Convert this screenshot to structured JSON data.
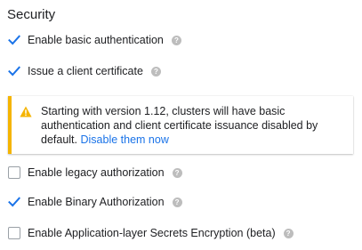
{
  "section": {
    "title": "Security"
  },
  "options": [
    {
      "label": "Enable basic authentication",
      "checked": true,
      "help_icon": "help-icon"
    },
    {
      "label": "Issue a client certificate",
      "checked": true,
      "help_icon": "help-icon"
    },
    {
      "label": "Enable legacy authorization",
      "checked": false,
      "help_icon": "help-icon"
    },
    {
      "label": "Enable Binary Authorization",
      "checked": true,
      "help_icon": "help-icon"
    },
    {
      "label": "Enable Application-layer Secrets Encryption (beta)",
      "checked": false,
      "help_icon": "help-icon"
    }
  ],
  "warning": {
    "icon": "warning-icon",
    "text": "Starting with version 1.12, clusters will have basic authentication and client certificate issuance disabled by default.",
    "link": "Disable them now"
  },
  "colors": {
    "checkbox_check": "#1a73e8",
    "link": "#1a73e8",
    "warning_accent": "#f5b400",
    "help_icon": "#bdbdbd"
  }
}
